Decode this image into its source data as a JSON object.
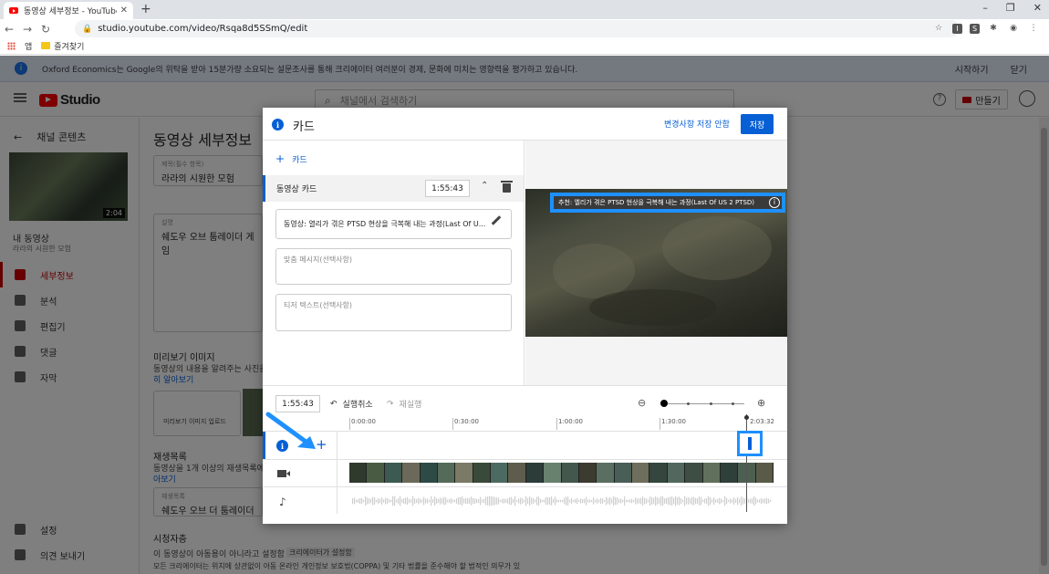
{
  "browser": {
    "tab_title": "동영상 세부정보 - YouTube Stu",
    "url": "studio.youtube.com/video/Rsqa8d5SSmQ/edit",
    "bookmarks": [
      "앱",
      "즐겨찾기"
    ]
  },
  "banner": {
    "text": "Oxford Economics는 Google의 위탁을 받아 15분가량 소요되는 설문조사를 통해 크리에이터 여러분이 경제, 문화에 미치는 영향력을 평가하고 있습니다.",
    "start": "시작하기",
    "close": "닫기"
  },
  "header": {
    "logo": "Studio",
    "search_placeholder": "채널에서 검색하기",
    "create": "만들기"
  },
  "sidebar": {
    "back": "채널 콘텐츠",
    "duration": "2:04",
    "my_video": "내 동영상",
    "my_video_sub": "라라의 시원한 모험",
    "items": [
      "세부정보",
      "분석",
      "편집기",
      "댓글",
      "자막"
    ],
    "bottom_items": [
      "설정",
      "의견 보내기"
    ]
  },
  "page": {
    "title": "동영상 세부정보",
    "title_label": "제목(필수 항목)",
    "title_value": "라라의 시원한 모험",
    "desc_label": "설명",
    "desc_value": "쉐도우 오브 툼레이더 게임 ",
    "thumb_head": "미리보기 이미지",
    "thumb_text": "동영상의 내용을 알려주는 사진을 ",
    "thumb_link": "히 알아보기",
    "upload_thumb": "미리보기 이미지 업로드",
    "playlist_head": "재생목록",
    "playlist_text": "동영상을 1개 이상의 재생목록에 ",
    "playlist_link": "아보기",
    "playlist_label": "재생목록",
    "playlist_value": "쉐도우 오브 더 툼레이더",
    "audience_head": "시청자층",
    "audience_sub": "이 동영상이 아동용이 아니라고 설정함",
    "audience_badge": "크리에이터가 설정함",
    "audience_text": "모든 크리에이터는 위치에 상관없이 아동 온라인 개인정보 보호법(COPPA) 및 기타 법률을 준수해야 할 법적인 의무가 있"
  },
  "modal": {
    "title": "카드",
    "discard": "변경사항 저장 안함",
    "save": "저장",
    "add_card": "카드",
    "card_title": "동영상 카드",
    "card_time": "1:55:43",
    "video_field": "동영상: 열리가 겪은 PTSD 현상을 극복해 내는 과정(Last Of U...",
    "custom_message_ph": "맞춤 메시지(선택사항)",
    "teaser_ph": "티저 텍스트(선택사항)",
    "teaser_preview": "추천: 엘리가 겪은 PTSD 현상을 극복해 내는 과정(Last Of US 2 PTSD)",
    "timeline_time": "1:55:43",
    "undo": "실행취소",
    "redo": "재실행",
    "ticks": [
      "0:00:00",
      "0:30:00",
      "1:00:00",
      "1:30:00",
      "2:03:32"
    ]
  },
  "colors": {
    "accent": "#065fd4",
    "highlight": "#1e90ff",
    "brand_red": "#ff0000"
  }
}
